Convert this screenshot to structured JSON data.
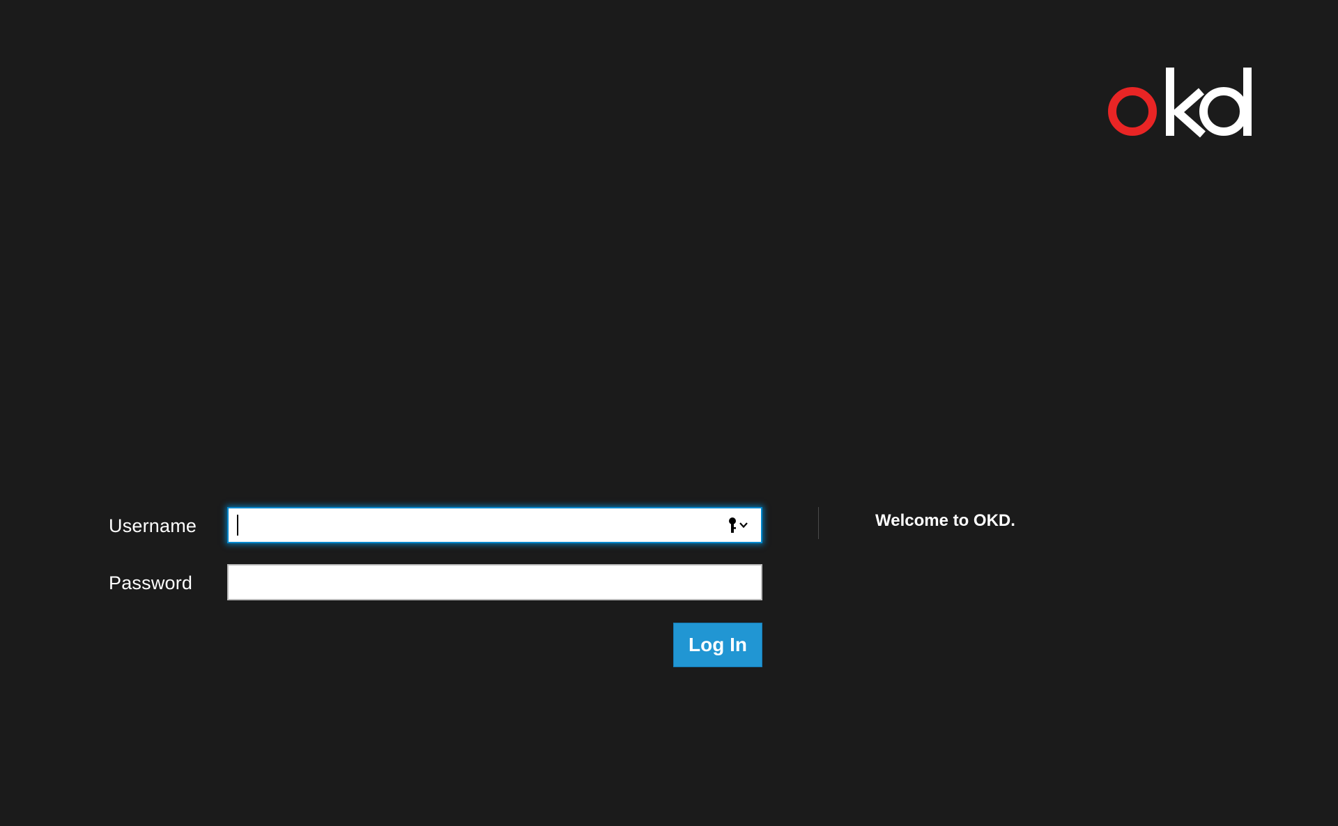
{
  "brand": {
    "logo_text": "okd",
    "accent_color": "#e92525",
    "logo_color": "#ffffff"
  },
  "login_form": {
    "username_label": "Username",
    "username_value": "",
    "password_label": "Password",
    "password_value": "",
    "submit_label": "Log In"
  },
  "icons": {
    "username_autofill": "key-icon"
  },
  "welcome": {
    "message": "Welcome to OKD."
  },
  "colors": {
    "background": "#1b1b1b",
    "button": "#2196d3",
    "focus_ring": "#0088ce"
  }
}
